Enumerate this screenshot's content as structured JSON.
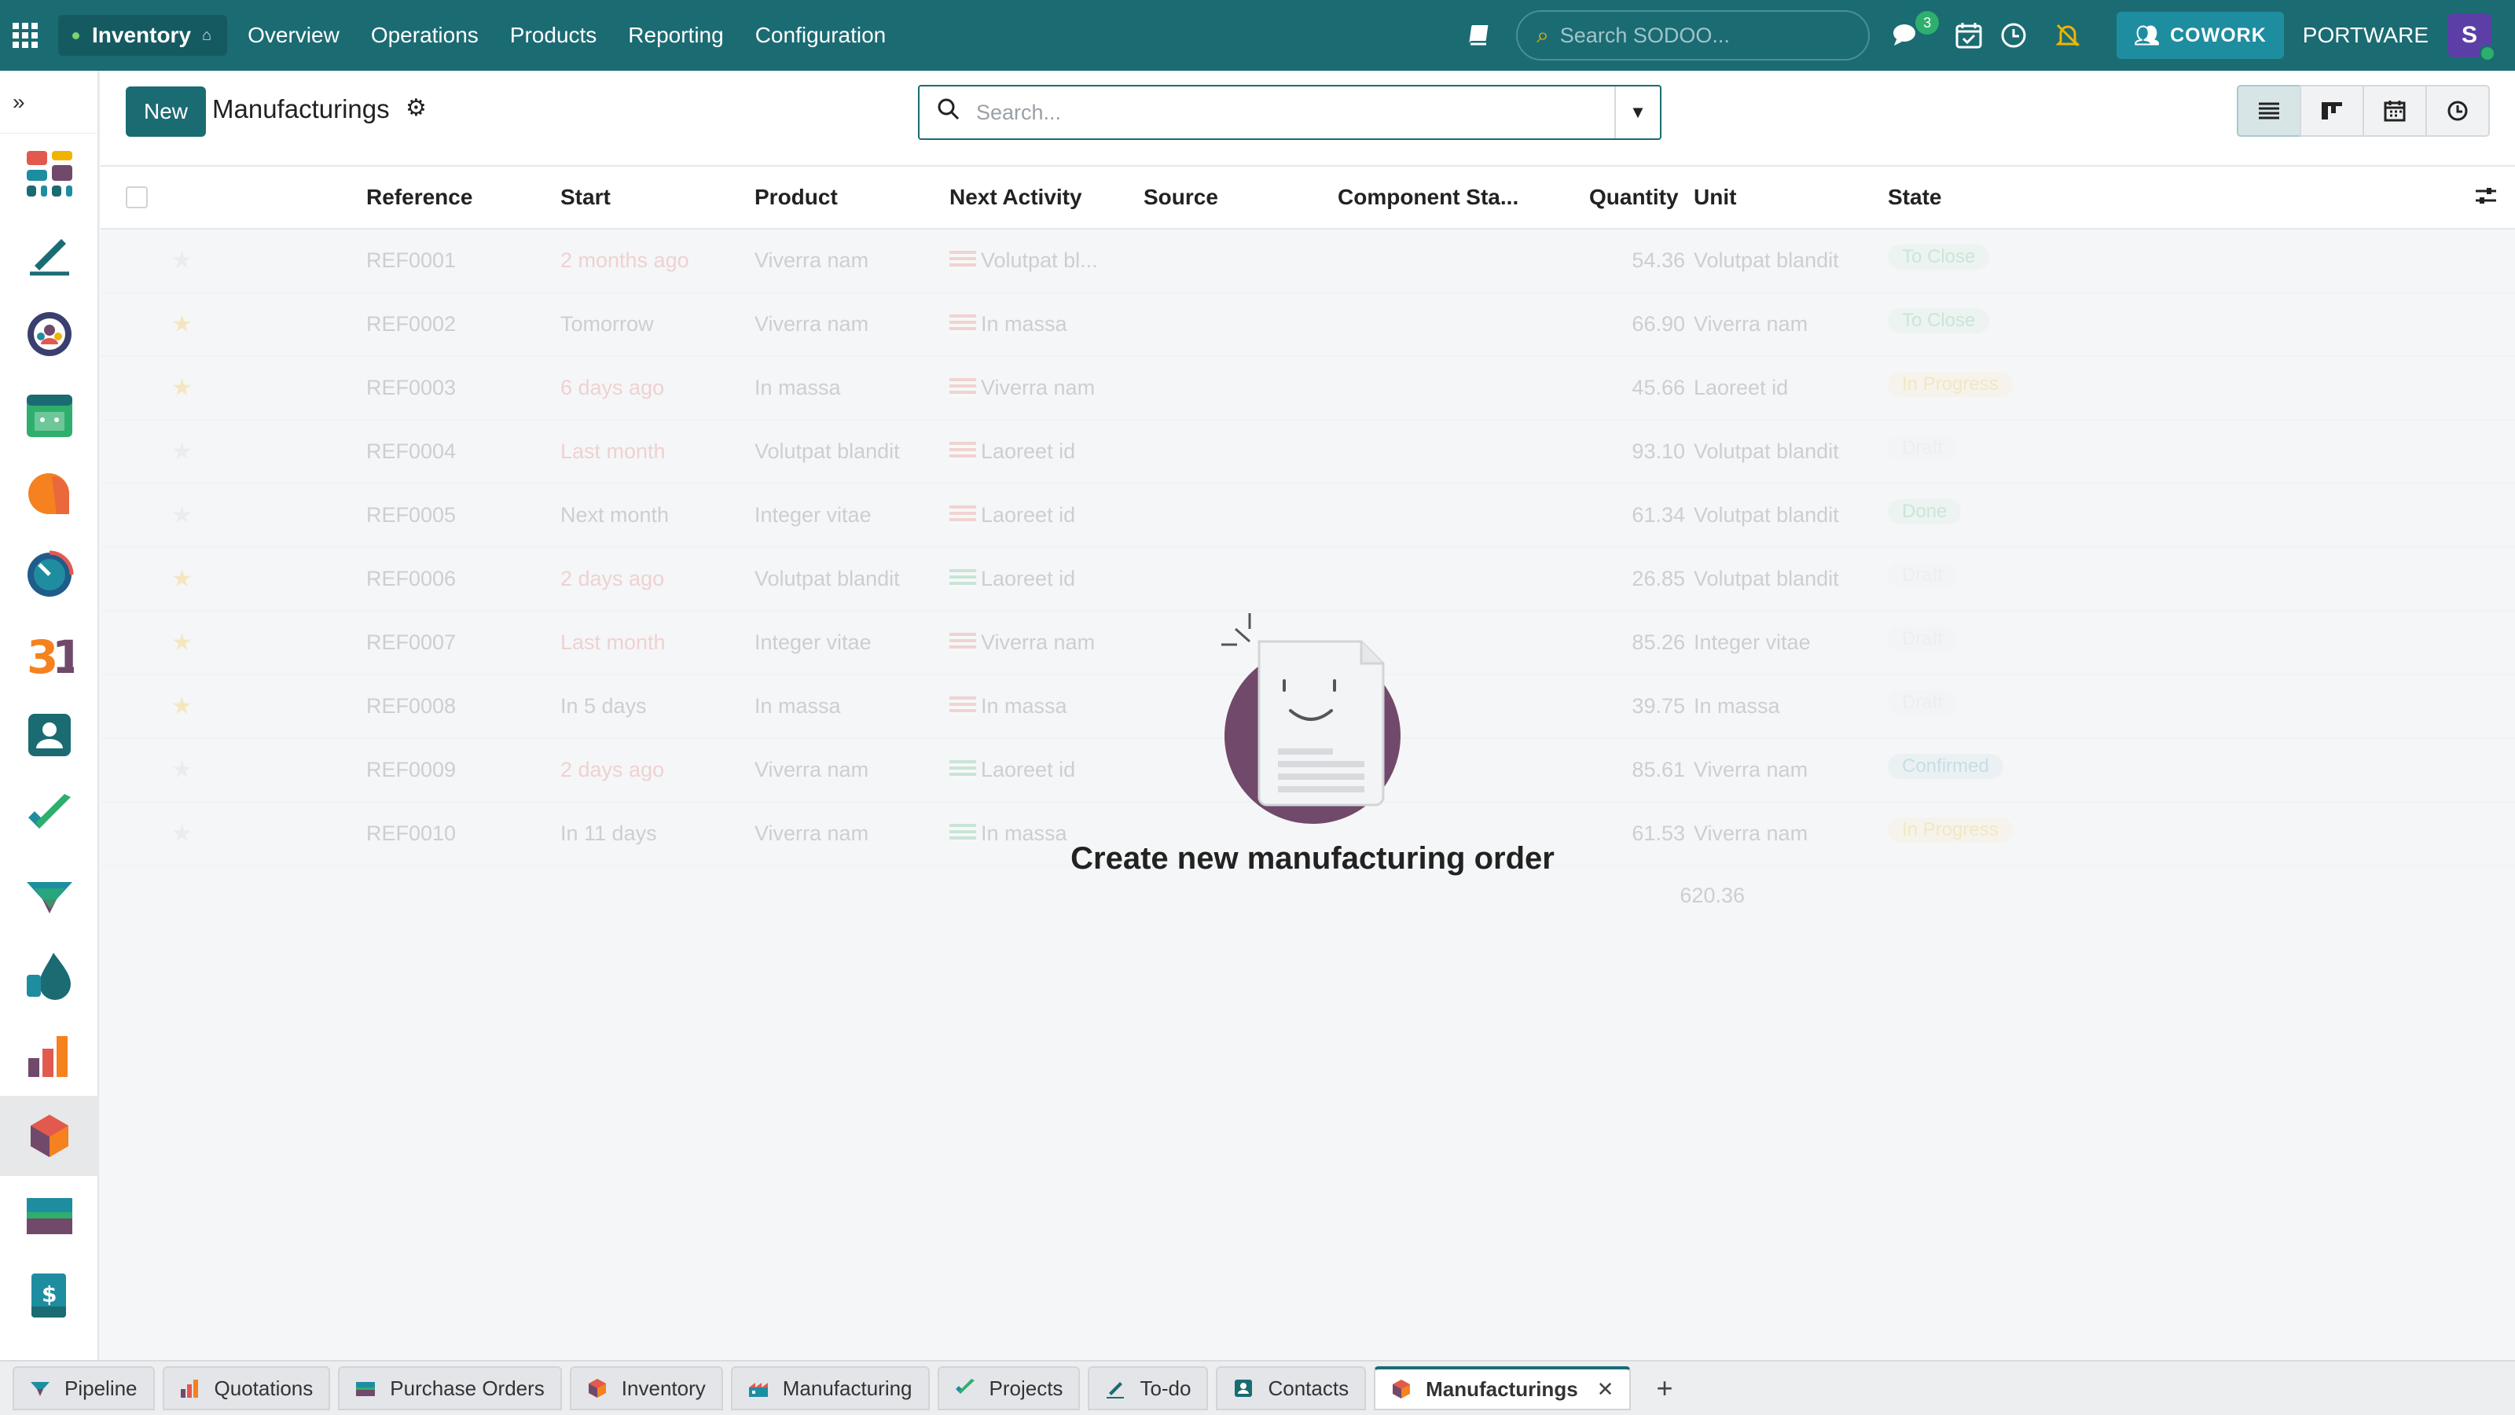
{
  "topbar": {
    "app_name": "Inventory",
    "menu": [
      "Overview",
      "Operations",
      "Products",
      "Reporting",
      "Configuration"
    ],
    "search_placeholder": "Search SODOO...",
    "messages_badge": "3",
    "cowork_label": "COWORK",
    "company": "PORTWARE",
    "avatar_initial": "S"
  },
  "control": {
    "new_label": "New",
    "title": "Manufacturings",
    "search_placeholder": "Search..."
  },
  "columns": [
    "Reference",
    "Start",
    "Product",
    "Next Activity",
    "Source",
    "Component Sta...",
    "Quantity",
    "Unit",
    "State"
  ],
  "rows": [
    {
      "ref": "REF0001",
      "start": "2 months ago",
      "product": "Viverra nam",
      "activity": "Volutpat bl...",
      "aflag": "r",
      "qty": "54.36",
      "unit": "Volutpat blandit",
      "state": "To Close",
      "state_color": "#2eaf6d",
      "star": false
    },
    {
      "ref": "REF0002",
      "start": "Tomorrow",
      "product": "Viverra nam",
      "activity": "In massa",
      "aflag": "r",
      "qty": "66.90",
      "unit": "Viverra nam",
      "state": "To Close",
      "state_color": "#2eaf6d",
      "star": true
    },
    {
      "ref": "REF0003",
      "start": "6 days ago",
      "product": "In massa",
      "activity": "Viverra nam",
      "aflag": "r",
      "qty": "45.66",
      "unit": "Laoreet id",
      "state": "In Progress",
      "state_color": "#f0b400",
      "star": true
    },
    {
      "ref": "REF0004",
      "start": "Last month",
      "product": "Volutpat blandit",
      "activity": "Laoreet id",
      "aflag": "r",
      "qty": "93.10",
      "unit": "Volutpat blandit",
      "state": "Draft",
      "state_color": "#cfd3d7",
      "star": false
    },
    {
      "ref": "REF0005",
      "start": "Next month",
      "product": "Integer vitae",
      "activity": "Laoreet id",
      "aflag": "r",
      "qty": "61.34",
      "unit": "Volutpat blandit",
      "state": "Done",
      "state_color": "#2eaf6d",
      "star": false
    },
    {
      "ref": "REF0006",
      "start": "2 days ago",
      "product": "Volutpat blandit",
      "activity": "Laoreet id",
      "aflag": "g",
      "qty": "26.85",
      "unit": "Volutpat blandit",
      "state": "Draft",
      "state_color": "#cfd3d7",
      "star": true
    },
    {
      "ref": "REF0007",
      "start": "Last month",
      "product": "Integer vitae",
      "activity": "Viverra nam",
      "aflag": "r",
      "qty": "85.26",
      "unit": "Integer vitae",
      "state": "Draft",
      "state_color": "#cfd3d7",
      "star": true
    },
    {
      "ref": "REF0008",
      "start": "In 5 days",
      "product": "In massa",
      "activity": "In massa",
      "aflag": "r",
      "qty": "39.75",
      "unit": "In massa",
      "state": "Draft",
      "state_color": "#cfd3d7",
      "star": true
    },
    {
      "ref": "REF0009",
      "start": "2 days ago",
      "product": "Viverra nam",
      "activity": "Laoreet id",
      "aflag": "g",
      "qty": "85.61",
      "unit": "Viverra nam",
      "state": "Confirmed",
      "state_color": "#1f8da0",
      "star": false
    },
    {
      "ref": "REF0010",
      "start": "In 11 days",
      "product": "Viverra nam",
      "activity": "In massa",
      "aflag": "g",
      "qty": "61.53",
      "unit": "Viverra nam",
      "state": "In Progress",
      "state_color": "#f0b400",
      "star": false
    }
  ],
  "total_qty": "620.36",
  "helper_title": "Create new manufacturing order",
  "tabs": [
    {
      "label": "Pipeline",
      "icon": "pipeline-icon"
    },
    {
      "label": "Quotations",
      "icon": "quotations-icon"
    },
    {
      "label": "Purchase Orders",
      "icon": "purchase-icon"
    },
    {
      "label": "Inventory",
      "icon": "inventory-icon"
    },
    {
      "label": "Manufacturing",
      "icon": "manufacturing-icon"
    },
    {
      "label": "Projects",
      "icon": "projects-icon"
    },
    {
      "label": "To-do",
      "icon": "todo-icon"
    },
    {
      "label": "Contacts",
      "icon": "contacts-icon"
    },
    {
      "label": "Manufacturings",
      "icon": "inventory-icon",
      "active": true
    }
  ],
  "colors": {
    "brand": "#1b6b73",
    "accent_purple": "#71496b"
  }
}
